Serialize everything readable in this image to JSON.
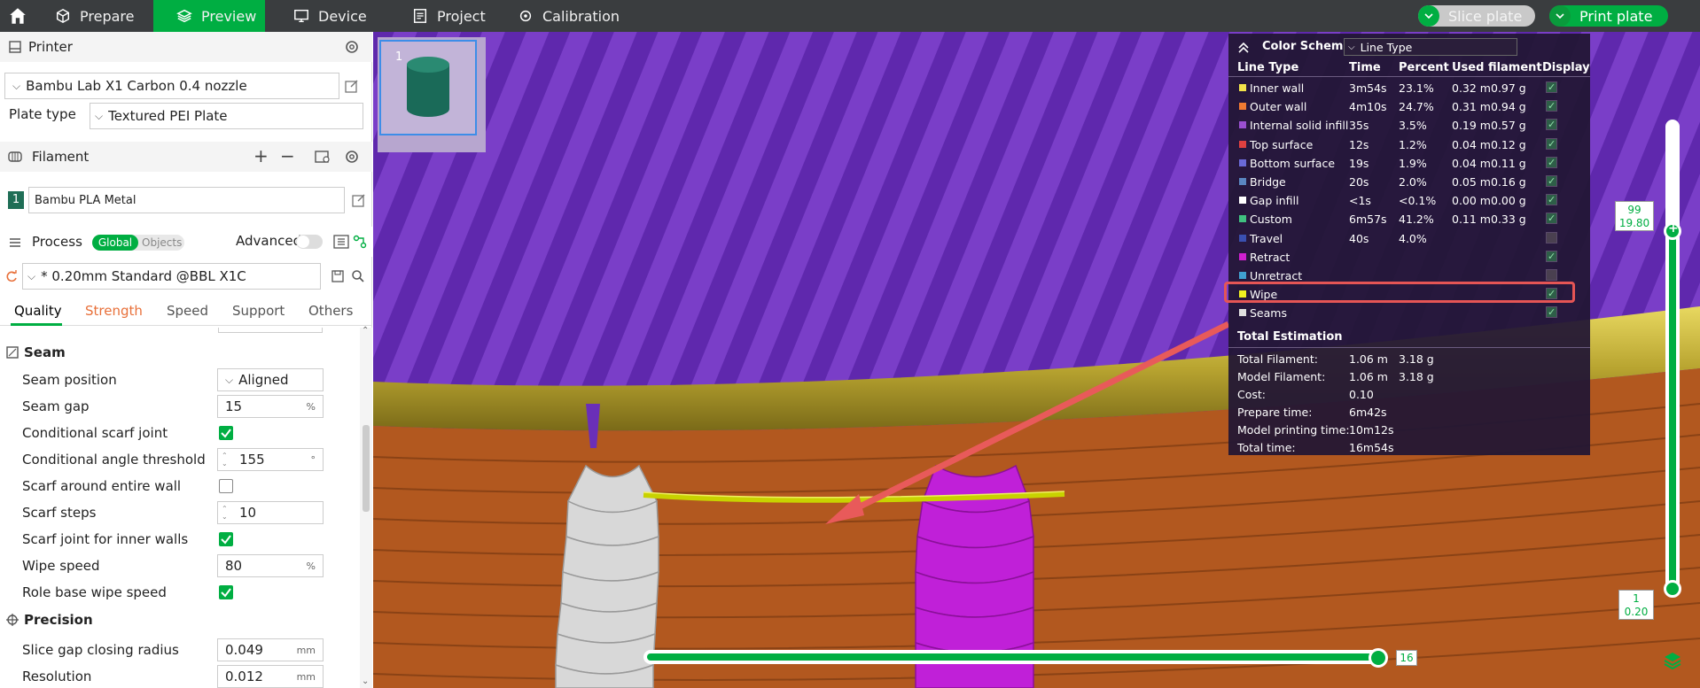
{
  "topbar": {
    "tabs": [
      "Prepare",
      "Preview",
      "Device",
      "Project",
      "Calibration"
    ],
    "slice_label": "Slice plate",
    "print_label": "Print plate"
  },
  "printer": {
    "section": "Printer",
    "name": "Bambu Lab X1 Carbon 0.4 nozzle",
    "plate_label": "Plate type",
    "plate_value": "Textured PEI Plate"
  },
  "filament": {
    "section": "Filament",
    "index": "1",
    "name": "Bambu PLA Metal",
    "color": "#1f6e56"
  },
  "process": {
    "section": "Process",
    "toggle_global": "Global",
    "toggle_objects": "Objects",
    "advanced": "Advanced",
    "preset": "* 0.20mm Standard @BBL X1C",
    "tabs": [
      "Quality",
      "Strength",
      "Speed",
      "Support",
      "Others"
    ]
  },
  "seam": {
    "title": "Seam",
    "position_label": "Seam position",
    "position_value": "Aligned",
    "gap_label": "Seam gap",
    "gap_value": "15",
    "gap_unit": "%",
    "cond_scarf_label": "Conditional scarf joint",
    "angle_label": "Conditional angle threshold",
    "angle_value": "155",
    "angle_unit": "°",
    "scarf_entire_label": "Scarf around entire wall",
    "scarf_steps_label": "Scarf steps",
    "scarf_steps_value": "10",
    "scarf_inner_label": "Scarf joint for inner walls",
    "wipe_speed_label": "Wipe speed",
    "wipe_speed_value": "80",
    "wipe_speed_unit": "%",
    "role_wipe_label": "Role base wipe speed"
  },
  "precision": {
    "title": "Precision",
    "gap_radius_label": "Slice gap closing radius",
    "gap_radius_value": "0.049",
    "gap_radius_unit": "mm",
    "resolution_label": "Resolution",
    "resolution_value": "0.012",
    "resolution_unit": "mm"
  },
  "plate_thumb": {
    "number": "1"
  },
  "legend": {
    "scheme_label": "Color Scheme",
    "scheme_value": "Line Type",
    "headers": [
      "Line Type",
      "Time",
      "Percent",
      "Used filament",
      "Display"
    ],
    "rows": [
      {
        "name": "Inner wall",
        "time": "3m54s",
        "percent": "23.1%",
        "len": "0.32 m",
        "weight": "0.97 g",
        "color": "#f2e24a",
        "display": true
      },
      {
        "name": "Outer wall",
        "time": "4m10s",
        "percent": "24.7%",
        "len": "0.31 m",
        "weight": "0.94 g",
        "color": "#f07b32",
        "display": true
      },
      {
        "name": "Internal solid infill",
        "time": "35s",
        "percent": "3.5%",
        "len": "0.19 m",
        "weight": "0.57 g",
        "color": "#9a4fd0",
        "display": true
      },
      {
        "name": "Top surface",
        "time": "12s",
        "percent": "1.2%",
        "len": "0.04 m",
        "weight": "0.12 g",
        "color": "#e04040",
        "display": true
      },
      {
        "name": "Bottom surface",
        "time": "19s",
        "percent": "1.9%",
        "len": "0.04 m",
        "weight": "0.11 g",
        "color": "#6a6ad8",
        "display": true
      },
      {
        "name": "Bridge",
        "time": "20s",
        "percent": "2.0%",
        "len": "0.05 m",
        "weight": "0.16 g",
        "color": "#5a86c0",
        "display": true
      },
      {
        "name": "Gap infill",
        "time": "<1s",
        "percent": "<0.1%",
        "len": "0.00 m",
        "weight": "0.00 g",
        "color": "#ffffff",
        "display": true
      },
      {
        "name": "Custom",
        "time": "6m57s",
        "percent": "41.2%",
        "len": "0.11 m",
        "weight": "0.33 g",
        "color": "#40c080",
        "display": true
      },
      {
        "name": "Travel",
        "time": "40s",
        "percent": "4.0%",
        "len": "",
        "weight": "",
        "color": "#3a50b0",
        "display": false
      },
      {
        "name": "Retract",
        "time": "",
        "percent": "",
        "len": "",
        "weight": "",
        "color": "#d020d0",
        "display": true
      },
      {
        "name": "Unretract",
        "time": "",
        "percent": "",
        "len": "",
        "weight": "",
        "color": "#40a0d0",
        "display": false
      },
      {
        "name": "Wipe",
        "time": "",
        "percent": "",
        "len": "",
        "weight": "",
        "color": "#f0f020",
        "display": true
      },
      {
        "name": "Seams",
        "time": "",
        "percent": "",
        "len": "",
        "weight": "",
        "color": "#e0e0e0",
        "display": true
      }
    ],
    "total_title": "Total Estimation",
    "totals": [
      {
        "label": "Total Filament:",
        "v1": "1.06 m",
        "v2": "3.18 g"
      },
      {
        "label": "Model Filament:",
        "v1": "1.06 m",
        "v2": "3.18 g"
      },
      {
        "label": "Cost:",
        "v1": "0.10",
        "v2": ""
      },
      {
        "label": "Prepare time:",
        "v1": "6m42s",
        "v2": ""
      },
      {
        "label": "Model printing time:",
        "v1": "10m12s",
        "v2": ""
      },
      {
        "label": "Total time:",
        "v1": "16m54s",
        "v2": ""
      }
    ]
  },
  "layer_slider": {
    "top_layer": "99",
    "top_height": "19.80",
    "bottom_layer": "1",
    "bottom_height": "0.20"
  },
  "move_slider": {
    "value": "16"
  },
  "colors": {
    "accent": "#00ae42",
    "highlight": "#e55555",
    "wipe_line": "#c8d200"
  }
}
